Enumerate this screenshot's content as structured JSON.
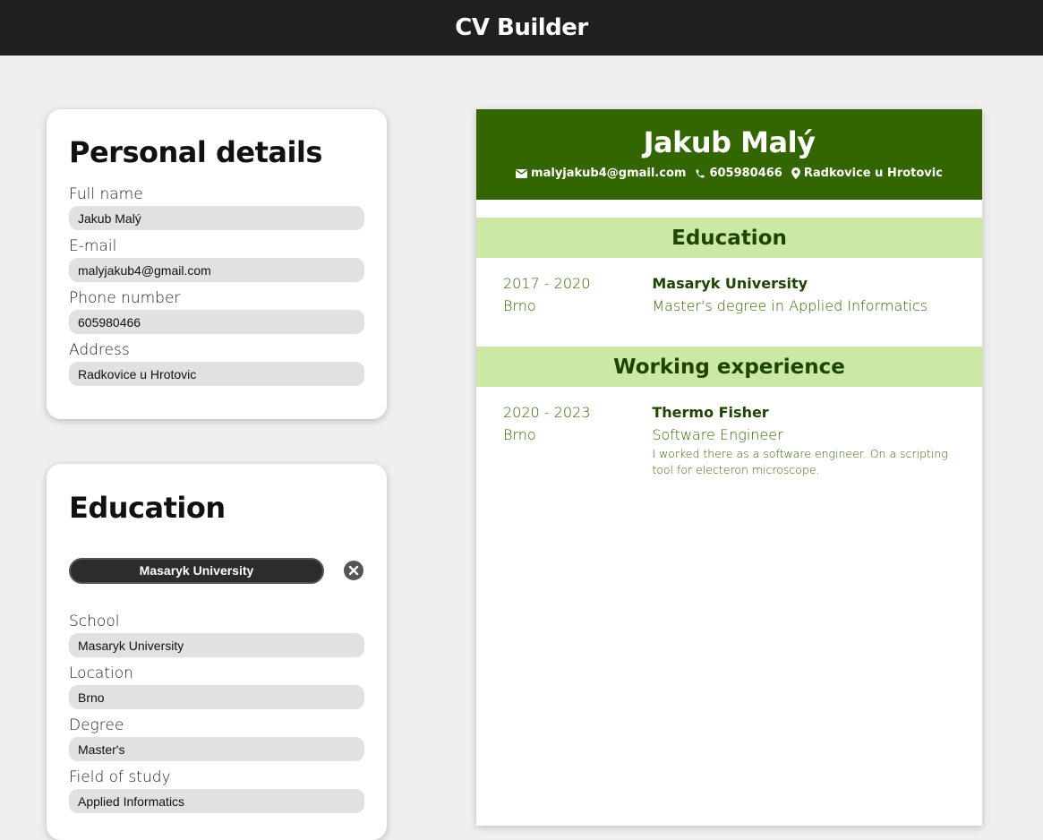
{
  "app": {
    "title": "CV Builder"
  },
  "personal": {
    "heading": "Personal details",
    "fields": [
      {
        "label": "Full name",
        "value": "Jakub Malý"
      },
      {
        "label": "E-mail",
        "value": "malyjakub4@gmail.com"
      },
      {
        "label": "Phone number",
        "value": "605980466"
      },
      {
        "label": "Address",
        "value": "Radkovice u Hrotovic"
      }
    ]
  },
  "education_form": {
    "heading": "Education",
    "entry_button": "Masaryk University",
    "fields": [
      {
        "label": "School",
        "value": "Masaryk University"
      },
      {
        "label": "Location",
        "value": "Brno"
      },
      {
        "label": "Degree",
        "value": "Master's"
      },
      {
        "label": "Field of study",
        "value": "Applied Informatics"
      }
    ]
  },
  "cv": {
    "name": "Jakub Malý",
    "email": "malyjakub4@gmail.com",
    "phone": "605980466",
    "address": "Radkovice u Hrotovic",
    "education": {
      "title": "Education",
      "entries": [
        {
          "dates": "2017 - 2020",
          "location": "Brno",
          "org": "Masaryk University",
          "role": "Master's degree in Applied Informatics"
        }
      ]
    },
    "work": {
      "title": "Working experience",
      "entries": [
        {
          "dates": "2020 - 2023",
          "location": "Brno",
          "org": "Thermo Fisher",
          "role": "Software Engineer",
          "description": "I worked there as a software engineer. On a scripting tool for electeron microscope."
        }
      ]
    }
  },
  "colors": {
    "topbar": "#1f1f1f",
    "cv_header": "#336600",
    "cv_section_bg": "#cbe8a4",
    "cv_text": "#336600"
  }
}
